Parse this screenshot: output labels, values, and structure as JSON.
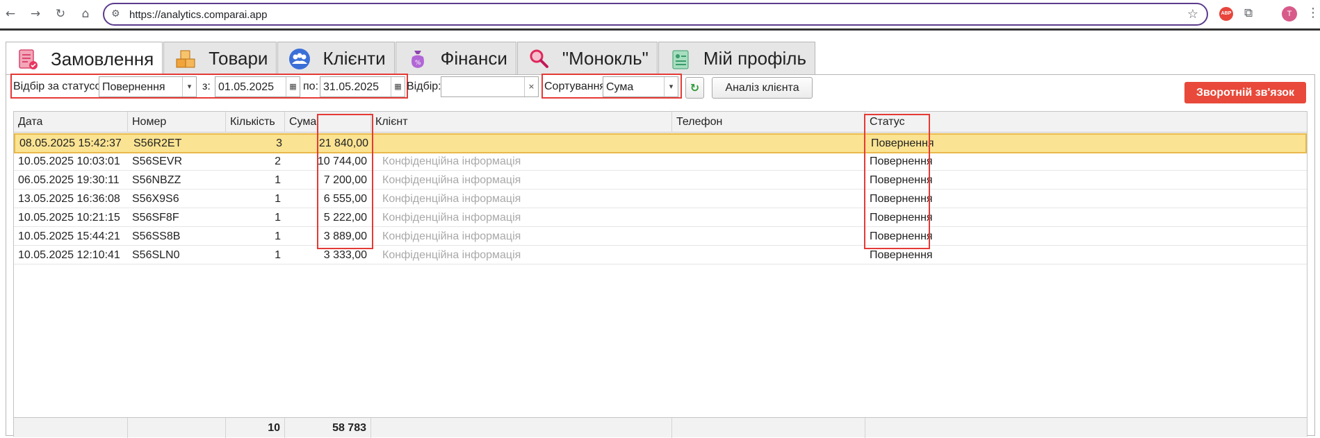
{
  "browser": {
    "url": "https://analytics.comparai.app",
    "avatar_letter": "T",
    "abp_label": "ABP"
  },
  "tabs": [
    {
      "label": "Замовлення",
      "active": true,
      "icon": "orders-icon"
    },
    {
      "label": "Товари",
      "active": false,
      "icon": "boxes-icon"
    },
    {
      "label": "Клієнти",
      "active": false,
      "icon": "clients-icon"
    },
    {
      "label": "Фінанси",
      "active": false,
      "icon": "money-bag-icon"
    },
    {
      "label": "\"Монокль\"",
      "active": false,
      "icon": "magnifier-icon"
    },
    {
      "label": "Мій профіль",
      "active": false,
      "icon": "profile-icon"
    }
  ],
  "toolbar": {
    "status_filter_label": "Відбір за статусом:",
    "status_filter_value": "Повернення",
    "from_label": "з:",
    "from_date": "01.05.2025",
    "to_label": "по:",
    "to_date": "31.05.2025",
    "filter_label": "Відбір:",
    "filter_value": "",
    "clear_symbol": "×",
    "sort_label": "Сортування:",
    "sort_value": "Сума",
    "analysis_button": "Аналіз клієнта",
    "feedback_button": "Зворотній зв'язок"
  },
  "table": {
    "columns": [
      "Дата",
      "Номер",
      "Кількість",
      "Сума",
      "Клієнт",
      "Телефон",
      "Статус"
    ],
    "rows": [
      {
        "date": "08.05.2025 15:42:37",
        "number": "S56R2ET",
        "qty": "3",
        "sum": "21 840,00",
        "client": "",
        "phone": "",
        "status": "Повернення",
        "selected": true
      },
      {
        "date": "10.05.2025 10:03:01",
        "number": "S56SEVR",
        "qty": "2",
        "sum": "10 744,00",
        "client": "Конфіденційна інформація",
        "phone": "",
        "status": "Повернення",
        "selected": false
      },
      {
        "date": "06.05.2025 19:30:11",
        "number": "S56NBZZ",
        "qty": "1",
        "sum": "7 200,00",
        "client": "Конфіденційна інформація",
        "phone": "",
        "status": "Повернення",
        "selected": false
      },
      {
        "date": "13.05.2025 16:36:08",
        "number": "S56X9S6",
        "qty": "1",
        "sum": "6 555,00",
        "client": "Конфіденційна інформація",
        "phone": "",
        "status": "Повернення",
        "selected": false
      },
      {
        "date": "10.05.2025 10:21:15",
        "number": "S56SF8F",
        "qty": "1",
        "sum": "5 222,00",
        "client": "Конфіденційна інформація",
        "phone": "",
        "status": "Повернення",
        "selected": false
      },
      {
        "date": "10.05.2025 15:44:21",
        "number": "S56SS8B",
        "qty": "1",
        "sum": "3 889,00",
        "client": "Конфіденційна інформація",
        "phone": "",
        "status": "Повернення",
        "selected": false
      },
      {
        "date": "10.05.2025 12:10:41",
        "number": "S56SLN0",
        "qty": "1",
        "sum": "3 333,00",
        "client": "Конфіденційна інформація",
        "phone": "",
        "status": "Повернення",
        "selected": false
      }
    ],
    "totals": {
      "qty": "10",
      "sum": "58 783"
    }
  },
  "colors": {
    "accent_red": "#e53935",
    "feedback_button": "#e8493a",
    "selected_row": "#fae392",
    "url_border": "#5b3b8c"
  }
}
